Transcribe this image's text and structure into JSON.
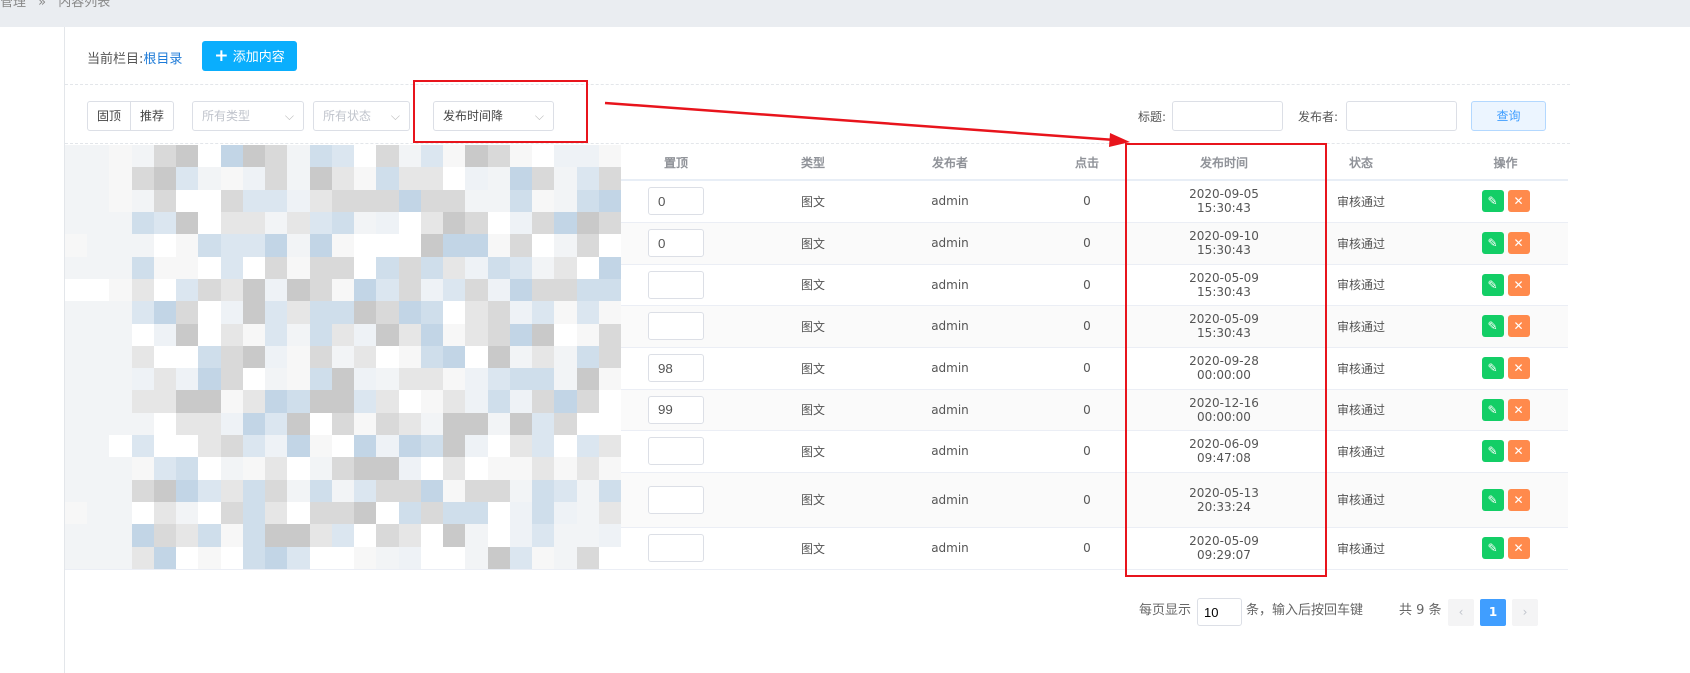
{
  "breadcrumb": {
    "parent": "管理",
    "sep": "»",
    "current": "内容列表"
  },
  "toolbar": {
    "current_label": "当前栏目:",
    "current_value": "根目录",
    "add_button": "添加内容"
  },
  "filters": {
    "btn_top": "固顶",
    "btn_recommend": "推荐",
    "type_select": "所有类型",
    "status_select": "所有状态",
    "sort_select": "发布时间降",
    "title_label": "标题:",
    "title_value": "",
    "publisher_label": "发布者:",
    "publisher_value": "",
    "query_button": "查询"
  },
  "table": {
    "headers": [
      "置顶",
      "类型",
      "发布者",
      "点击",
      "发布时间",
      "状态",
      "操作"
    ],
    "rows": [
      {
        "sort": "0",
        "type": "图文",
        "publisher": "admin",
        "clicks": "0",
        "time": "2020-09-05 15:30:43",
        "status": "审核通过"
      },
      {
        "sort": "0",
        "type": "图文",
        "publisher": "admin",
        "clicks": "0",
        "time": "2020-09-10 15:30:43",
        "status": "审核通过"
      },
      {
        "sort": "",
        "type": "图文",
        "publisher": "admin",
        "clicks": "0",
        "time": "2020-05-09 15:30:43",
        "status": "审核通过"
      },
      {
        "sort": "",
        "type": "图文",
        "publisher": "admin",
        "clicks": "0",
        "time": "2020-05-09 15:30:43",
        "status": "审核通过"
      },
      {
        "sort": "98",
        "type": "图文",
        "publisher": "admin",
        "clicks": "0",
        "time": "2020-09-28 00:00:00",
        "status": "审核通过"
      },
      {
        "sort": "99",
        "type": "图文",
        "publisher": "admin",
        "clicks": "0",
        "time": "2020-12-16 00:00:00",
        "status": "审核通过"
      },
      {
        "sort": "",
        "type": "图文",
        "publisher": "admin",
        "clicks": "0",
        "time": "2020-06-09 09:47:08",
        "status": "审核通过"
      },
      {
        "sort": "",
        "type": "图文",
        "publisher": "admin",
        "clicks": "0",
        "time": "2020-05-13 20:33:24",
        "status": "审核通过"
      },
      {
        "sort": "",
        "type": "图文",
        "publisher": "admin",
        "clicks": "0",
        "time": "2020-05-09 09:29:07",
        "status": "审核通过"
      }
    ]
  },
  "pagination": {
    "per_page_label": "每页显示",
    "per_page_value": "10",
    "hint": "条，输入后按回车键",
    "total": "共 9 条",
    "current_page": "1"
  },
  "colors": {
    "accent": "#0aaefd",
    "edit": "#13ce66",
    "delete": "#ff8a4c",
    "annotation": "#e8141c"
  }
}
